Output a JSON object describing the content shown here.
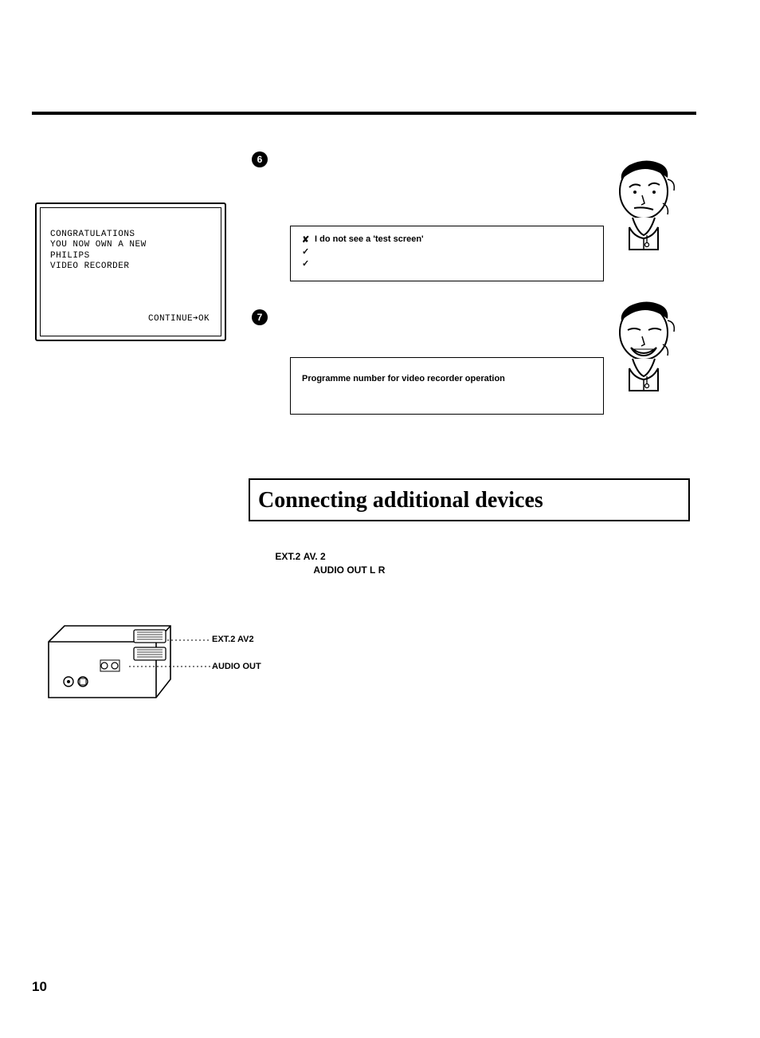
{
  "tv": {
    "line1": "CONGRATULATIONS",
    "line2": "YOU NOW OWN A NEW",
    "line3": "PHILIPS",
    "line4": "VIDEO RECORDER",
    "continue": "CONTINUE➔OK"
  },
  "steps": {
    "s6": "6",
    "s7": "7"
  },
  "callout1": {
    "x": "✘",
    "title": "I do not see a 'test screen'",
    "c1": "✓",
    "c2": "✓"
  },
  "callout2": {
    "title": "Programme number for video recorder operation"
  },
  "section": {
    "title": "Connecting additional devices",
    "ext2": "EXT.2",
    "av2": "AV. 2",
    "audioout": "AUDIO OUT",
    "l": "L",
    "r": "R"
  },
  "vcr": {
    "ext": "EXT.2 AV2",
    "audio": "AUDIO OUT"
  },
  "pagenum": "10"
}
